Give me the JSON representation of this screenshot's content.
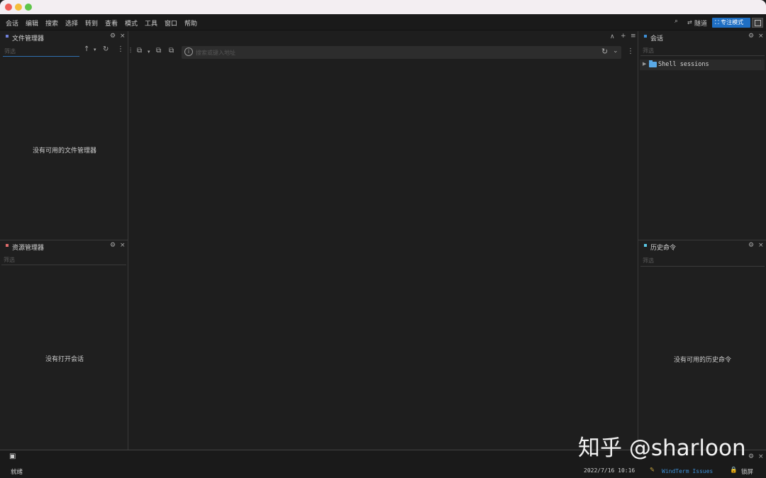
{
  "menubar": {
    "items": [
      "会话",
      "编辑",
      "搜索",
      "选择",
      "转到",
      "查看",
      "模式",
      "工具",
      "窗口",
      "帮助"
    ],
    "tunnel_label": "隧道",
    "focus_mode_label": "专注模式"
  },
  "file_manager": {
    "title": "文件管理器",
    "filter_placeholder": "筛选",
    "empty_message": "没有可用的文件管理器"
  },
  "resource_manager": {
    "title": "资源管理器",
    "filter_placeholder": "筛选",
    "empty_message": "没有打开会话"
  },
  "address_bar": {
    "placeholder": "搜索或键入地址"
  },
  "sessions": {
    "title": "会话",
    "filter_placeholder": "筛选",
    "tree": [
      {
        "label": "Shell sessions"
      }
    ]
  },
  "history": {
    "title": "历史命令",
    "filter_placeholder": "筛选",
    "empty_message": "没有可用的历史命令"
  },
  "status": {
    "state": "就绪",
    "datetime": "2022/7/16 10:16",
    "issues_link": "WindTerm Issues",
    "lock_label": "锁屏"
  },
  "watermark": "知乎 @sharloon",
  "colors": {
    "accent": "#1f6fc4",
    "file_manager_dot": "#6f7fd8",
    "resource_manager_dot": "#e06c6c",
    "sessions_dot": "#3d8fd6",
    "history_dot": "#5ac8e6",
    "folder": "#5aa9e6"
  }
}
